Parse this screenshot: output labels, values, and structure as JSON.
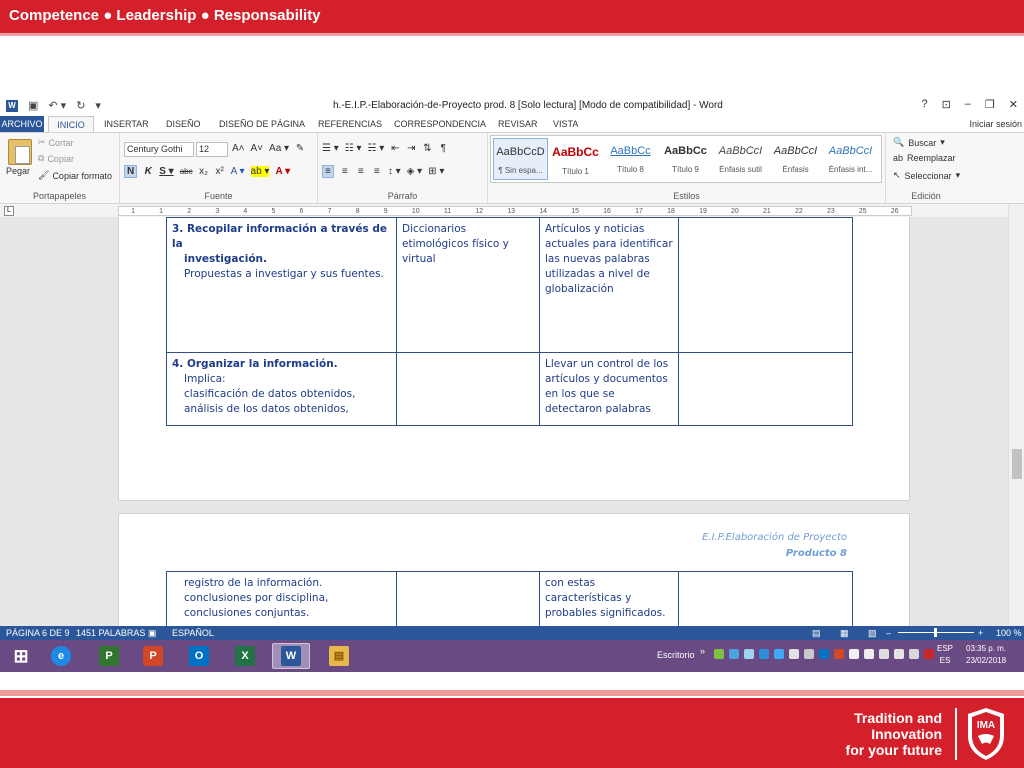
{
  "slide": {
    "top_text": "Competence ● Leadership ● Responsability",
    "tagline": [
      "Tradition and",
      "Innovation",
      "for your future"
    ],
    "logo_text": "IMA"
  },
  "word": {
    "title": "h.-E.I.P.-Elaboración-de-Proyecto prod. 8 [Solo lectura] [Modo de compatibilidad] - Word",
    "window_controls": [
      "?",
      "⊡",
      "–",
      "❐",
      "✕"
    ],
    "tabs": [
      "ARCHIVO",
      "INICIO",
      "INSERTAR",
      "DISEÑO",
      "DISEÑO DE PÁGINA",
      "REFERENCIAS",
      "CORRESPONDENCIA",
      "REVISAR",
      "VISTA"
    ],
    "sign_in": "Iniciar sesión",
    "ribbon": {
      "clipboard": {
        "paste": "Pegar",
        "cut": "Cortar",
        "copy": "Copiar",
        "format_painter": "Copiar formato",
        "label": "Portapapeles"
      },
      "font": {
        "family": "Century Gothi",
        "size": "12",
        "label": "Fuente",
        "row1": [
          "A˄",
          "A˅",
          "Aa ▾",
          "✎"
        ],
        "row2": [
          "N",
          "K",
          "S ▾",
          "abc",
          "x₂",
          "x²",
          "A ▾",
          "ab ▾",
          "A ▾"
        ]
      },
      "paragraph": {
        "label": "Párrafo",
        "row1": [
          "☰ ▾",
          "☷ ▾",
          "☵ ▾",
          "⇤",
          "⇥",
          "⇅",
          "¶"
        ],
        "row2": [
          "≡",
          "≡",
          "≡",
          "≡",
          "↕ ▾",
          "◈ ▾",
          "⊞ ▾"
        ]
      },
      "styles": {
        "label": "Estilos",
        "items": [
          {
            "sample": "AaBbCcD",
            "name": "¶ Sin espa..."
          },
          {
            "sample": "AaBbCc",
            "name": "Título 1"
          },
          {
            "sample": "AaBbCc",
            "name": "Título 8"
          },
          {
            "sample": "AaBbCc",
            "name": "Título 9"
          },
          {
            "sample": "AaBbCcI",
            "name": "Énfasis sutil"
          },
          {
            "sample": "AaBbCcI",
            "name": "Énfasis"
          },
          {
            "sample": "AaBbCcI",
            "name": "Énfasis int..."
          }
        ]
      },
      "editing": {
        "label": "Edición",
        "find": "Buscar",
        "replace": "Reemplazar",
        "select": "Seleccionar"
      }
    },
    "ruler": [
      "1",
      "1",
      "2",
      "3",
      "4",
      "5",
      "6",
      "7",
      "8",
      "9",
      "10",
      "11",
      "12",
      "13",
      "14",
      "15",
      "16",
      "17",
      "18",
      "19",
      "20",
      "21",
      "22",
      "23",
      "25",
      "26"
    ],
    "page2_header": {
      "line1": "E.I.P.Elaboración de Proyecto",
      "line2": "Producto 8"
    },
    "table_page1": [
      {
        "c1_bold": "3. Recopilar información a través de la",
        "c1_bold2": "investigación.",
        "c1_rest": [
          "Propuestas a investigar y sus fuentes."
        ],
        "c2": "Diccionarios etimológicos físico y virtual",
        "c3": "Artículos y noticias actuales para identificar las nuevas palabras utilizadas a nivel de globalización",
        "c4": ""
      },
      {
        "c1_bold": "4. Organizar la información.",
        "c1_bold2": "",
        "c1_rest": [
          "Implica:",
          "clasificación de datos obtenidos,",
          "análisis de los datos obtenidos,"
        ],
        "c2": "",
        "c3": "Llevar un control de los artículos  y documentos en los que se detectaron palabras",
        "c4": ""
      }
    ],
    "table_page2": {
      "c1": [
        "registro de la información.",
        "conclusiones por disciplina,",
        "conclusiones conjuntas."
      ],
      "c2": "",
      "c3": "con estas características y probables significados.",
      "c4": ""
    },
    "status": {
      "page": "PÁGINA 6 DE 9",
      "words": "1451 PALABRAS",
      "lang": "ESPAÑOL",
      "zoom": "100 %"
    }
  },
  "taskbar": {
    "desktop_label": "Escritorio",
    "lang": [
      "ESP",
      "ES"
    ],
    "time": "03:35 p. m.",
    "date": "23/02/2018",
    "apps": [
      {
        "name": "start",
        "glyph": "⊞",
        "color": "#6a4a83"
      },
      {
        "name": "internet-explorer",
        "glyph": "e",
        "color": "#1e88e5"
      },
      {
        "name": "project",
        "glyph": "P",
        "color": "#31752f"
      },
      {
        "name": "powerpoint",
        "glyph": "P",
        "color": "#d24726"
      },
      {
        "name": "outlook",
        "glyph": "O",
        "color": "#0072c6"
      },
      {
        "name": "excel",
        "glyph": "X",
        "color": "#217346"
      },
      {
        "name": "word",
        "glyph": "W",
        "color": "#2b579a"
      },
      {
        "name": "file-explorer",
        "glyph": "▤",
        "color": "#e8b84a"
      }
    ]
  }
}
